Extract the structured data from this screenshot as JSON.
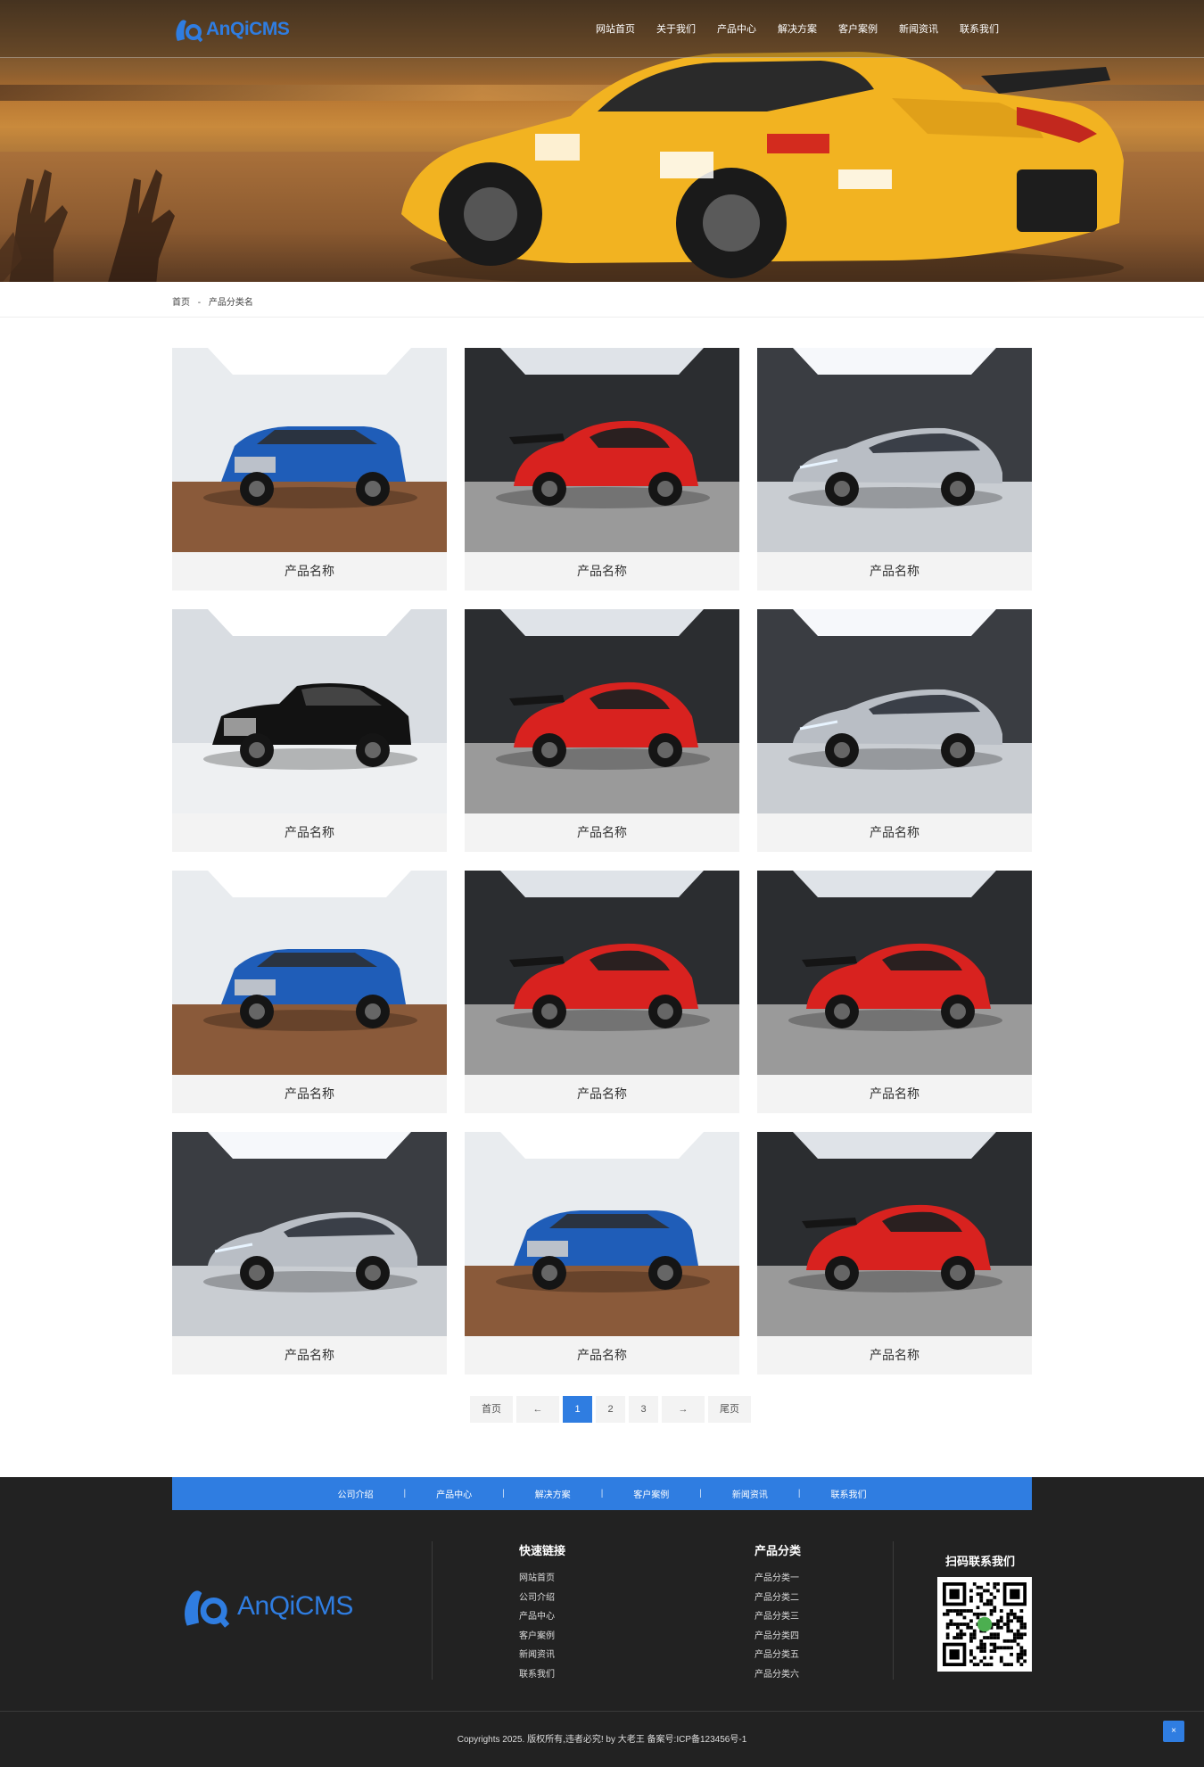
{
  "header": {
    "logo_text": "AnQiCMS",
    "nav": [
      "网站首页",
      "关于我们",
      "产品中心",
      "解决方案",
      "客户案例",
      "新闻资讯",
      "联系我们"
    ]
  },
  "breadcrumb": {
    "home": "首页",
    "sep": "-",
    "current": "产品分类名"
  },
  "products": [
    {
      "name": "产品名称",
      "image": "blue-suv"
    },
    {
      "name": "产品名称",
      "image": "red-sportscar"
    },
    {
      "name": "产品名称",
      "image": "silver-concept"
    },
    {
      "name": "产品名称",
      "image": "black-sedan"
    },
    {
      "name": "产品名称",
      "image": "red-sportscar"
    },
    {
      "name": "产品名称",
      "image": "silver-concept"
    },
    {
      "name": "产品名称",
      "image": "blue-suv"
    },
    {
      "name": "产品名称",
      "image": "red-sportscar"
    },
    {
      "name": "产品名称",
      "image": "red-sportscar"
    },
    {
      "name": "产品名称",
      "image": "silver-concept"
    },
    {
      "name": "产品名称",
      "image": "blue-suv"
    },
    {
      "name": "产品名称",
      "image": "red-sportscar"
    }
  ],
  "pagination": {
    "first": "首页",
    "prev": "←",
    "pages": [
      "1",
      "2",
      "3"
    ],
    "current": "1",
    "next": "→",
    "last": "尾页"
  },
  "footer": {
    "nav": [
      "公司介绍",
      "产品中心",
      "解决方案",
      "客户案例",
      "新闻资讯",
      "联系我们"
    ],
    "nav_sep": "|",
    "logo_text": "AnQiCMS",
    "quick_links": {
      "title": "快速链接",
      "items": [
        "网站首页",
        "公司介绍",
        "产品中心",
        "客户案例",
        "新闻资讯",
        "联系我们"
      ]
    },
    "categories": {
      "title": "产品分类",
      "items": [
        "产品分类一",
        "产品分类二",
        "产品分类三",
        "产品分类四",
        "产品分类五",
        "产品分类六"
      ]
    },
    "qr_title": "扫码联系我们",
    "copyright": "Copyrights 2025. 版权所有,违者必究! by 大老王 备案号:ICP备123456号-1",
    "back_to_top": "×"
  },
  "colors": {
    "accent": "#2f7de1",
    "footer_bg": "#222222",
    "card_bg": "#f3f3f3"
  }
}
